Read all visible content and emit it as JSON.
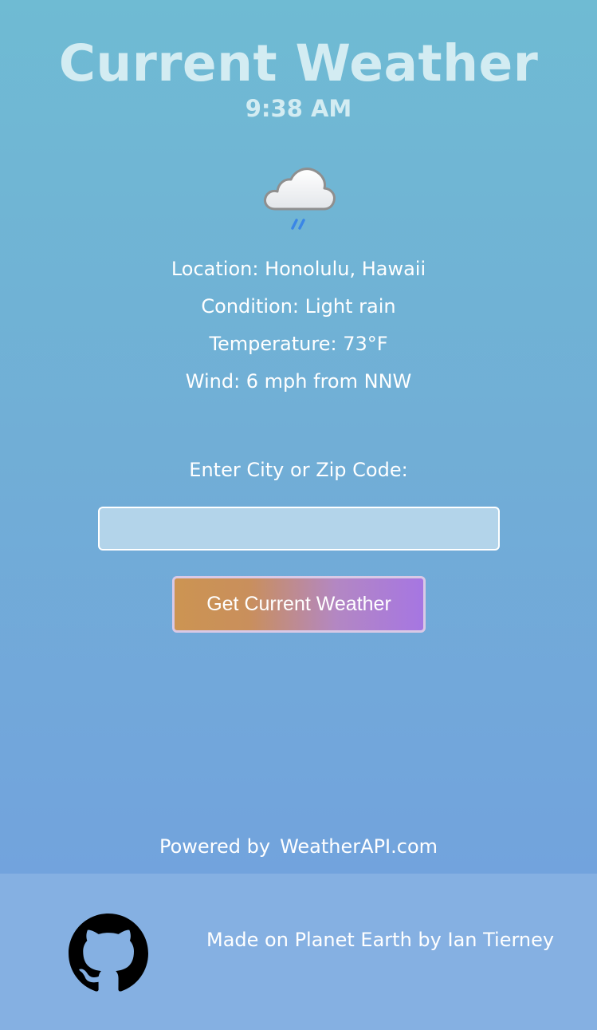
{
  "header": {
    "title": "Current Weather",
    "time": "9:38 AM"
  },
  "current": {
    "icon": "light-rain-cloud-icon",
    "location": "Location: Honolulu, Hawaii",
    "condition": "Condition: Light rain",
    "temperature": "Temperature: 73°F",
    "wind": "Wind: 6 mph from NNW"
  },
  "search": {
    "label": "Enter City or Zip Code:",
    "value": "",
    "button_label": "Get Current Weather"
  },
  "attribution": {
    "prefix": "Powered by",
    "link_text": "WeatherAPI.com"
  },
  "footer": {
    "icon": "github-icon",
    "text": "Made on Planet Earth by Ian Tierney"
  },
  "colors": {
    "background_top": "#6fbbd3",
    "background_bottom": "#72a3dd",
    "footer_bg": "#85b0e2",
    "button_gradient_start": "#cc9452",
    "button_gradient_end": "#a676e2"
  }
}
